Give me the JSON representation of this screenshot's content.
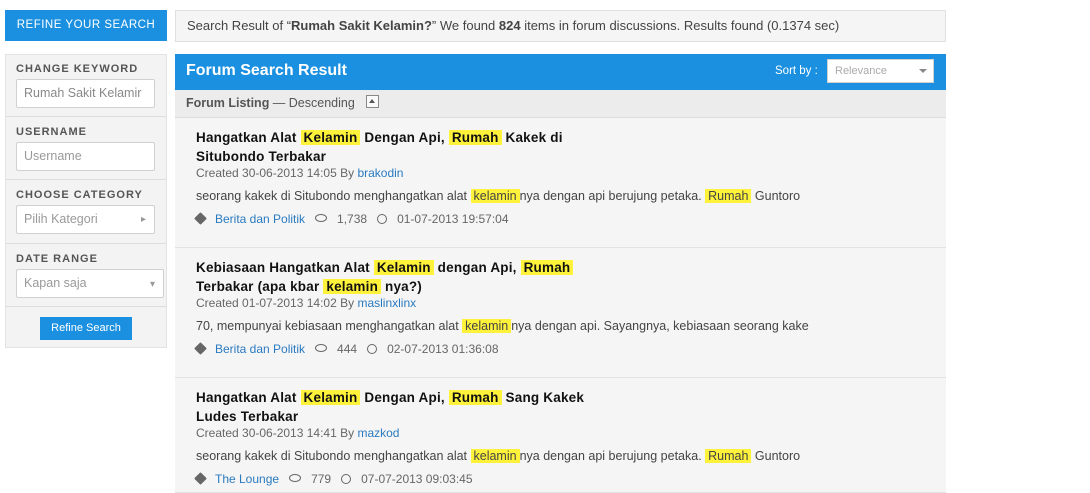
{
  "sidebar": {
    "refine_header": "REFINE YOUR SEARCH",
    "keyword_label": "CHANGE KEYWORD",
    "keyword_value": "Rumah Sakit Kelamir",
    "username_label": "USERNAME",
    "username_placeholder": "Username",
    "category_label": "CHOOSE CATEGORY",
    "category_placeholder": "Pilih Kategori",
    "date_label": "DATE RANGE",
    "date_value": "Kapan saja",
    "refine_button": "Refine Search"
  },
  "result_bar": {
    "prefix": "Search Result of “",
    "query": "Rumah Sakit Kelamin?",
    "middle": "” We found ",
    "count": "824",
    "suffix": " items in forum discussions. Results found (0.1374 sec)"
  },
  "forum": {
    "title": "Forum Search Result",
    "sort_label": "Sort by :",
    "sort_value": "Relevance",
    "listing_label": "Forum Listing",
    "listing_order": " — Descending"
  },
  "results": [
    {
      "title_parts": [
        "Hangatkan Alat ",
        "Kelamin",
        " Dengan Api, ",
        "Rumah",
        " Kakek di Situbondo Terbakar"
      ],
      "created": "Created 30-06-2013 14:05 By ",
      "author": "brakodin",
      "snippet_parts": [
        "seorang kakek di Situbondo menghangatkan alat ",
        "kelamin",
        "nya dengan api berujung petaka. ",
        "Rumah",
        " Guntoro"
      ],
      "category": "Berita dan Politik",
      "views": "1,738",
      "last_post": "01-07-2013 19:57:04"
    },
    {
      "title_parts": [
        "Kebiasaan Hangatkan Alat ",
        "Kelamin",
        " dengan Api, ",
        "Rumah",
        " Terbakar (apa kbar ",
        "kelamin",
        " nya?)"
      ],
      "created": "Created 01-07-2013 14:02 By ",
      "author": "maslinxlinx",
      "snippet_parts": [
        "70, mempunyai kebiasaan menghangatkan alat ",
        "kelamin",
        "nya dengan api. Sayangnya, kebiasaan seorang kake"
      ],
      "category": "Berita dan Politik",
      "views": "444",
      "last_post": "02-07-2013 01:36:08"
    },
    {
      "title_parts": [
        "Hangatkan Alat ",
        "Kelamin",
        " Dengan Api, ",
        "Rumah",
        " Sang Kakek Ludes Terbakar"
      ],
      "created": "Created 30-06-2013 14:41 By ",
      "author": "mazkod",
      "snippet_parts": [
        "seorang kakek di Situbondo menghangatkan alat ",
        "kelamin",
        "nya dengan api berujung petaka. ",
        "Rumah",
        " Guntoro"
      ],
      "category": "The Lounge",
      "views": "779",
      "last_post": "07-07-2013 09:03:45"
    }
  ]
}
